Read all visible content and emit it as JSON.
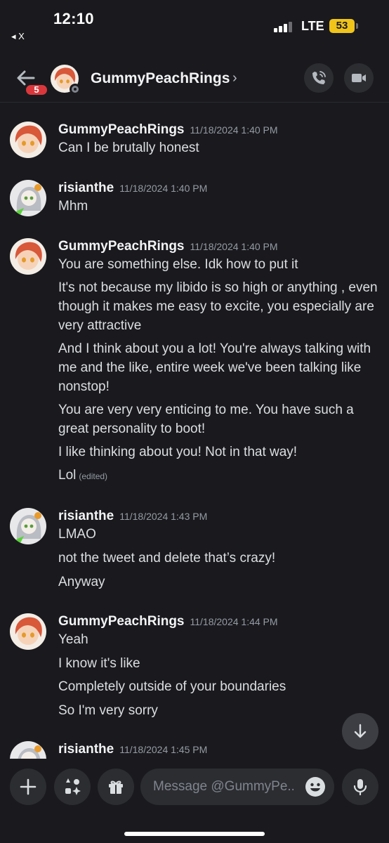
{
  "status_bar": {
    "time": "12:10",
    "back_app": "◂ X",
    "network": "LTE",
    "battery": "53"
  },
  "header": {
    "unread_badge": "5",
    "username": "GummyPeachRings",
    "chevron": "›",
    "back_icon": "arrow-left-icon",
    "call_icon": "phone-icon",
    "video_icon": "video-camera-icon"
  },
  "colors": {
    "background": "#1a1a1e",
    "badge": "#da373c",
    "surface": "#2b2d31",
    "battery": "#f0c419"
  },
  "messages": [
    {
      "author": "GummyPeachRings",
      "timestamp": "11/18/2024 1:40 PM",
      "lines": [
        "Can I be brutally honest"
      ]
    },
    {
      "author": "risianthe",
      "timestamp": "11/18/2024 1:40 PM",
      "lines": [
        "Mhm"
      ]
    },
    {
      "author": "GummyPeachRings",
      "timestamp": "11/18/2024 1:40 PM",
      "lines": [
        "You are something else. Idk how to put it",
        "It's not because my libido is so high or anything , even though it makes me easy to excite, you especially are very attractive",
        "And I think about you a lot! You're always talking with me and the like, entire week we've been talking like nonstop!",
        "You are very very enticing to me. You have such a great personality to boot!",
        "I like thinking about you! Not in that way!",
        "Lol"
      ],
      "edited_label": "(edited)"
    },
    {
      "author": "risianthe",
      "timestamp": "11/18/2024 1:43 PM",
      "lines": [
        "LMAO",
        "not the tweet and delete that’s crazy!",
        "Anyway"
      ]
    },
    {
      "author": "GummyPeachRings",
      "timestamp": "11/18/2024 1:44 PM",
      "lines": [
        "Yeah",
        "I know it's like",
        "Completely outside of your boundaries",
        "So I'm very sorry"
      ]
    },
    {
      "author": "risianthe",
      "timestamp": "11/18/2024 1:45 PM",
      "lines": []
    }
  ],
  "composer": {
    "placeholder": "Message @GummyPe...",
    "plus_icon": "plus-icon",
    "apps_icon": "apps-icon",
    "gift_icon": "gift-icon",
    "emoji_icon": "emoji-icon",
    "mic_icon": "microphone-icon"
  },
  "jump_icon": "arrow-down-icon"
}
